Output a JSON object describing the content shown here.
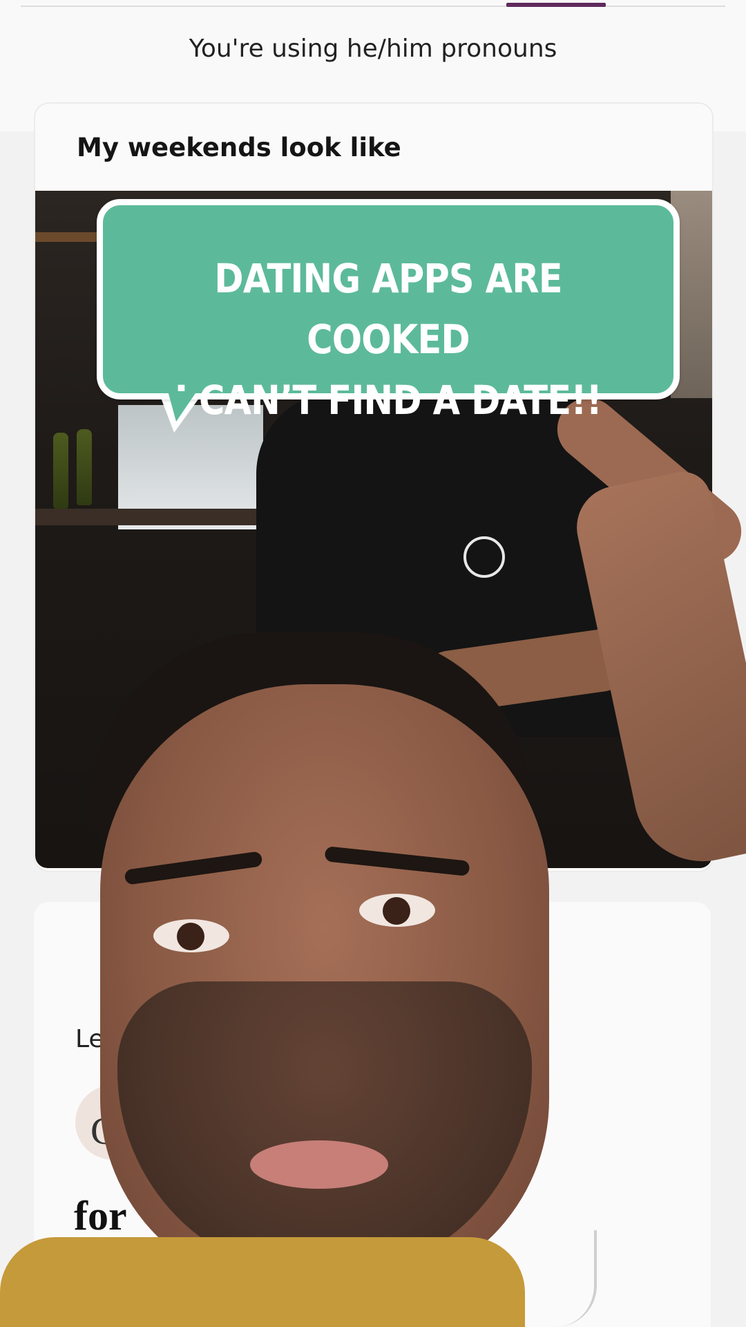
{
  "header": {
    "pronouns_text": "You're using he/him pronouns"
  },
  "prompt_card": {
    "title": "My weekends look like"
  },
  "overlay": {
    "caption_line1": "DATING APPS ARE COOKED",
    "caption_line2": "I CAN’T FIND A DATE!!",
    "caption_color": "#5cba9a"
  },
  "card2": {
    "label_partial": "Le",
    "pill_partial": "C",
    "body_partial": "for"
  },
  "colors": {
    "tab_indicator": "#5e2a5c",
    "background": "#f3f2f2",
    "card": "#fbfafa"
  }
}
